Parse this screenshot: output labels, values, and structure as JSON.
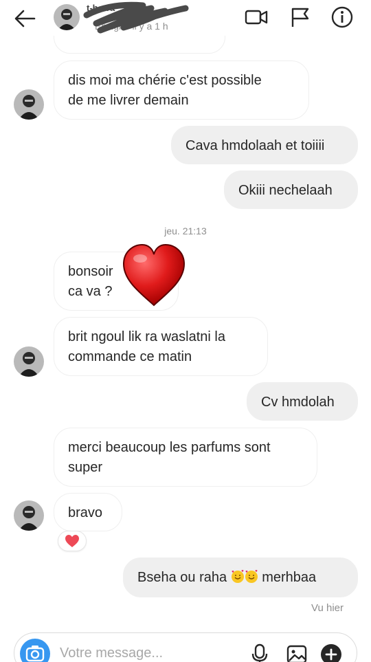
{
  "header": {
    "name": "t-herra",
    "status": "En ligne il y a 1 h"
  },
  "messages": {
    "m0": "dis moi ma chérie c'est possible\nde me livrer demain",
    "m1": "Cava hmdolaah et toiiii",
    "m2": "Okiii nechelaah",
    "ts1": "jeu. 21:13",
    "m3": "bonsoir\nca va ?",
    "m4": "brit ngoul lik ra waslatni la\ncommande ce matin",
    "m5": "Cv hmdolah",
    "m6": "merci beaucoup les parfums sont\nsuper",
    "m7": "bravo",
    "m8_pre": "Bseha ou raha ",
    "m8_post": " merhbaa",
    "seen": "Vu hier"
  },
  "composer": {
    "placeholder": "Votre message..."
  },
  "icons": {
    "back": "arrow-left-icon",
    "video": "video-call-icon",
    "flag": "flag-icon",
    "info": "info-icon",
    "camera": "camera-icon",
    "mic": "microphone-icon",
    "gallery": "gallery-icon",
    "plus": "plus-circle-icon"
  },
  "colors": {
    "accent": "#3797f0",
    "heart": "#ed4956",
    "bubble_out": "#efefef"
  }
}
